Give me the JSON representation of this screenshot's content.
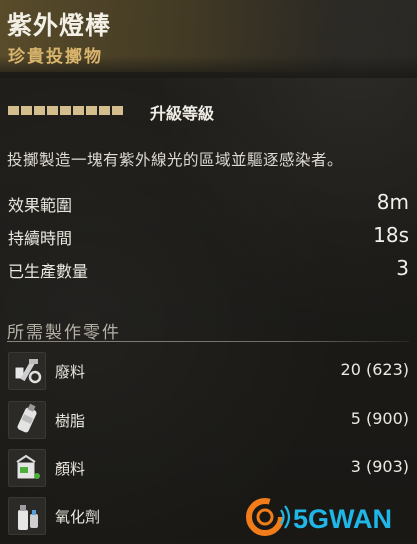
{
  "item": {
    "name": "紫外燈棒",
    "rarity": "珍貴投擲物"
  },
  "upgrade": {
    "label": "升級等級",
    "segments": 9
  },
  "description": "投擲製造一塊有紫外線光的區域並驅逐感染者。",
  "stats": [
    {
      "label": "效果範圍",
      "value": "8m"
    },
    {
      "label": "持續時間",
      "value": "18s"
    },
    {
      "label": "已生產數量",
      "value": "3"
    }
  ],
  "parts_section": {
    "title": "所需製作零件",
    "parts": [
      {
        "name": "廢料",
        "qty": "20 (623)",
        "icon": "scrap-icon"
      },
      {
        "name": "樹脂",
        "qty": "5 (900)",
        "icon": "resin-icon"
      },
      {
        "name": "顏料",
        "qty": "3 (903)",
        "icon": "paint-icon"
      },
      {
        "name": "氧化劑",
        "qty": "",
        "icon": "oxidizer-icon"
      }
    ]
  },
  "watermark": {
    "text": "5GWAN",
    "colors": {
      "orange": "#f07d1a",
      "blue": "#1fb7e8",
      "green": "#4fb848"
    }
  }
}
